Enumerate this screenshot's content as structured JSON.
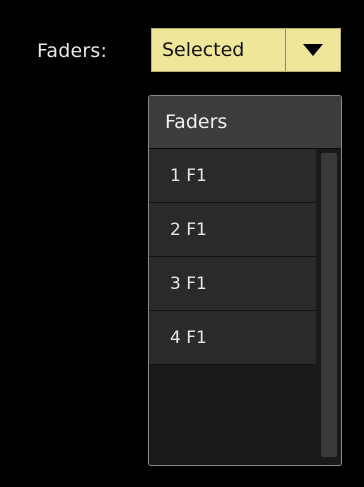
{
  "faders_label": "Faders:",
  "select": {
    "value": "Selected",
    "arrow_icon": "triangle-down-icon"
  },
  "dropdown": {
    "header": "Faders",
    "items": [
      {
        "label": "1 F1"
      },
      {
        "label": "2 F1"
      },
      {
        "label": "3 F1"
      },
      {
        "label": "4 F1"
      }
    ]
  },
  "colors": {
    "select_bg": "#efe69a",
    "background": "#000000",
    "header_bg": "#3c3c3c",
    "item_bg": "#2a2a2a"
  }
}
